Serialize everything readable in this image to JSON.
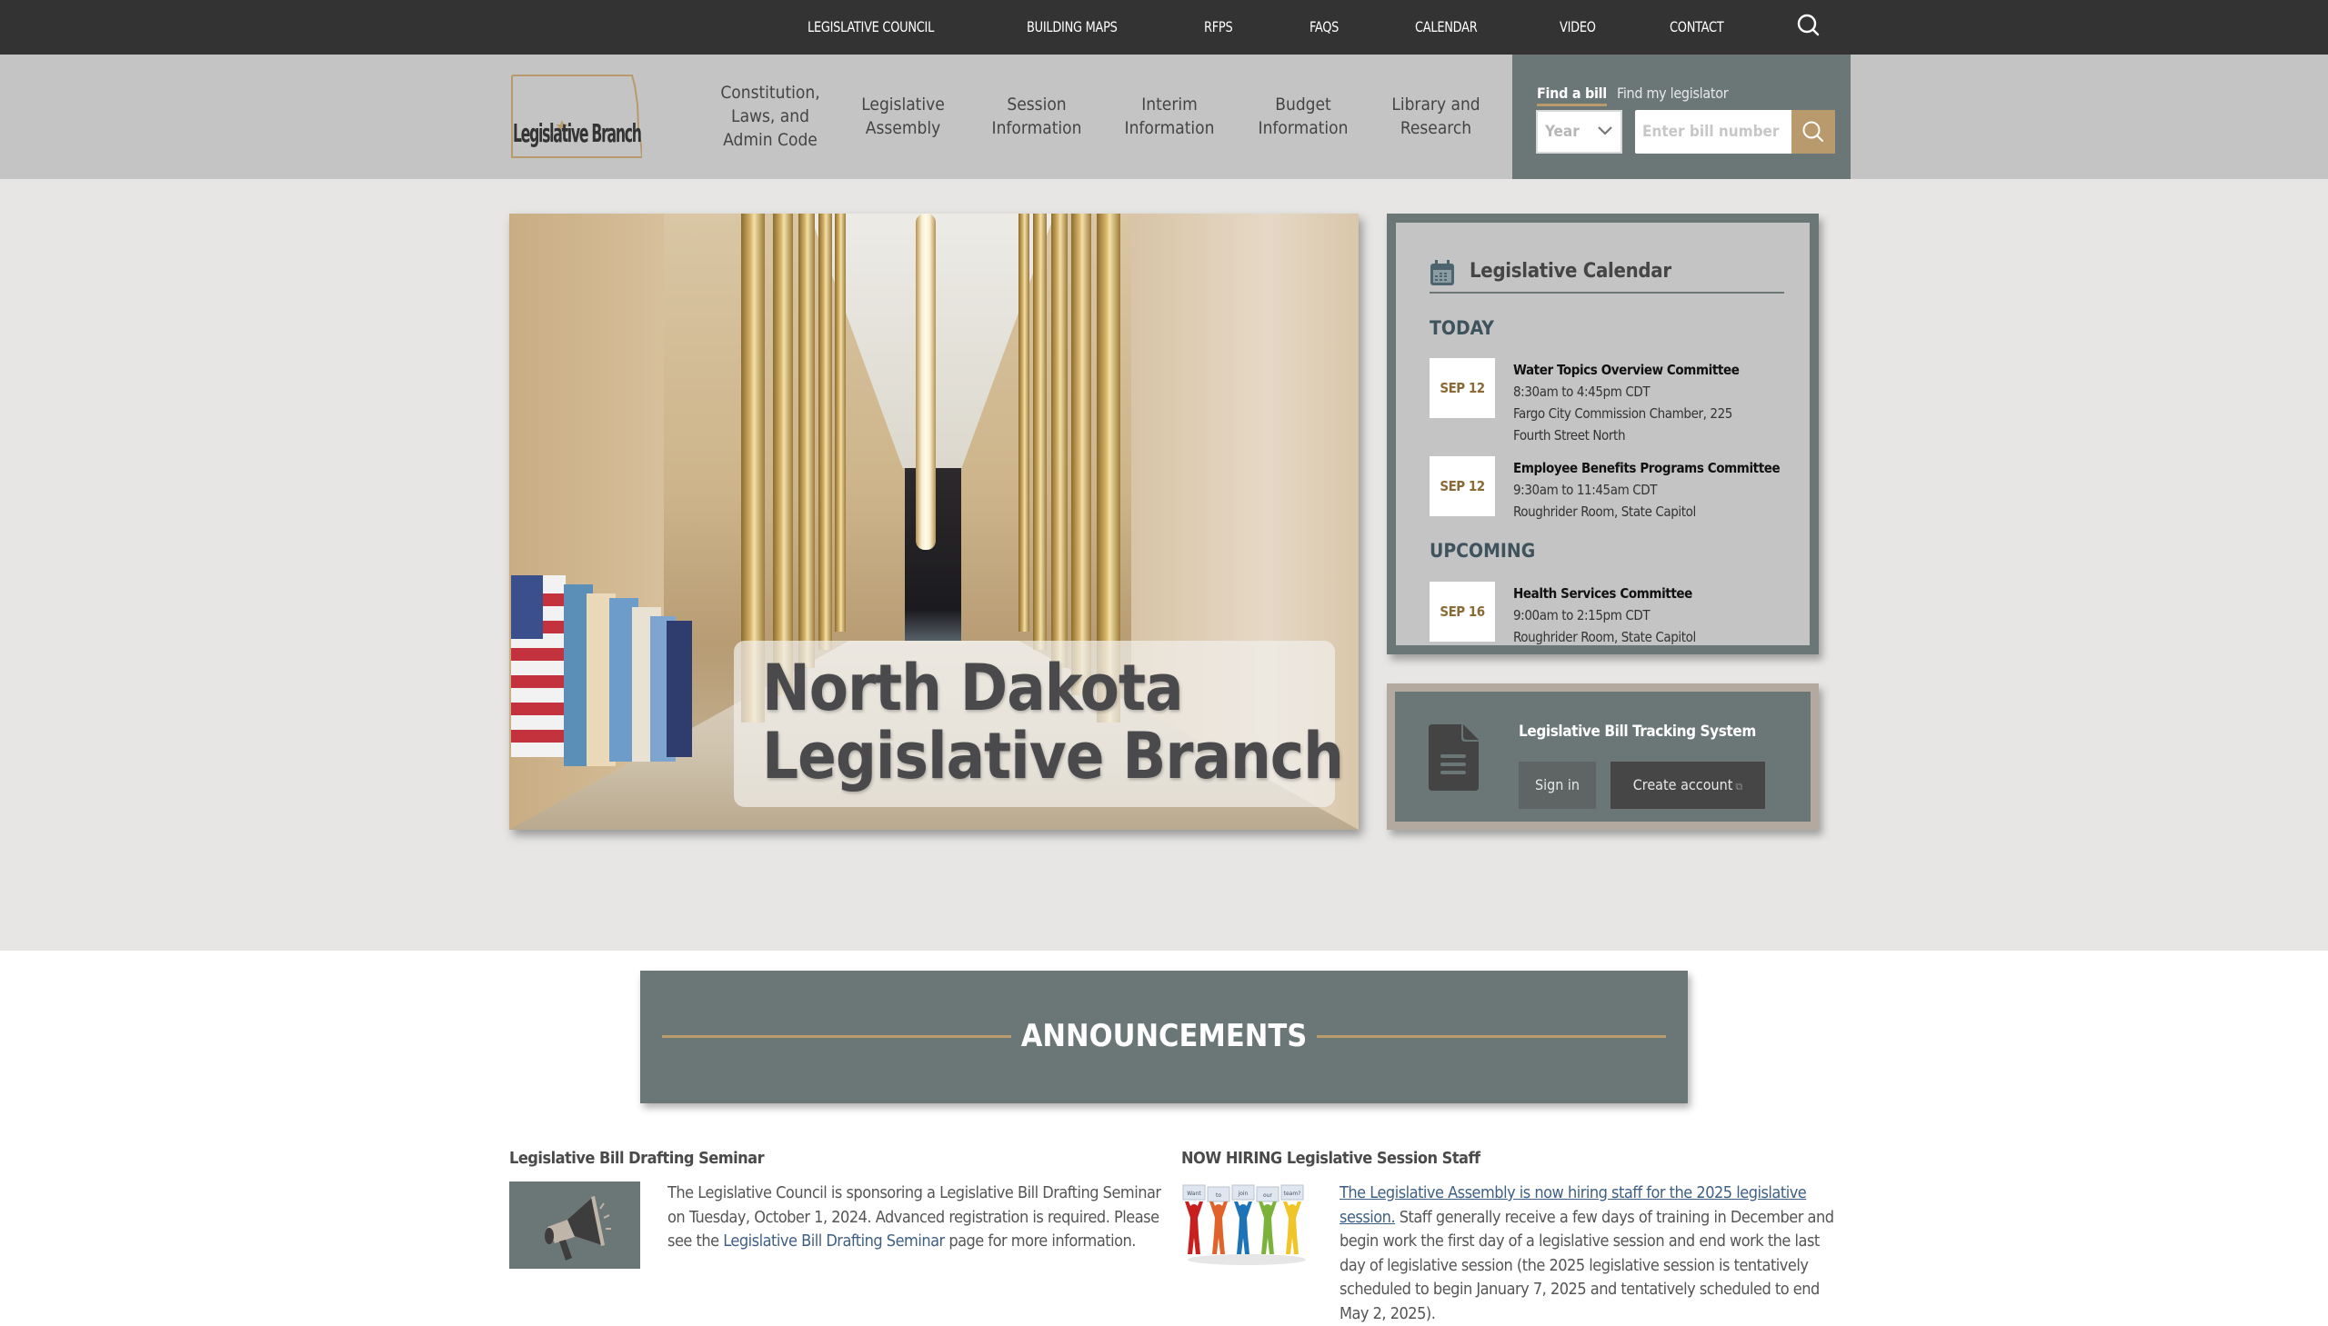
{
  "topbar": {
    "links": [
      {
        "label": "LEGISLATIVE COUNCIL"
      },
      {
        "label": "BUILDING MAPS"
      },
      {
        "label": "RFPS"
      },
      {
        "label": "FAQS"
      },
      {
        "label": "CALENDAR"
      },
      {
        "label": "VIDEO"
      },
      {
        "label": "CONTACT"
      }
    ],
    "search_icon": "search-icon"
  },
  "header": {
    "logo_text": "Legislative Branch",
    "nav": [
      {
        "line1": "Constitution,",
        "line2": "Laws, and",
        "line3": "Admin Code"
      },
      {
        "line1": "Legislative",
        "line2": "Assembly"
      },
      {
        "line1": "Session",
        "line2": "Information"
      },
      {
        "line1": "Interim",
        "line2": "Information"
      },
      {
        "line1": "Budget",
        "line2": "Information"
      },
      {
        "line1": "Library and",
        "line2": "Research"
      }
    ],
    "find": {
      "tabs": [
        {
          "label": "Find a bill",
          "active": true
        },
        {
          "label": "Find my legislator",
          "active": false
        }
      ],
      "year_select": "Year",
      "bill_placeholder": "Enter bill number",
      "search_icon": "search-icon"
    }
  },
  "hero": {
    "title_line1": "North Dakota",
    "title_line2": "Legislative Branch"
  },
  "calendar": {
    "title": "Legislative Calendar",
    "sections": [
      {
        "label": "TODAY",
        "events": [
          {
            "date": "SEP 12",
            "name": "Water Topics Overview Committee",
            "time": "8:30am to 4:45pm CDT",
            "location_line1": "Fargo City Commission Chamber, 225",
            "location_line2": "Fourth Street North"
          },
          {
            "date": "SEP 12",
            "name": "Employee Benefits Programs Committee",
            "time": "9:30am to 11:45am CDT",
            "location_line1": "Roughrider Room, State Capitol"
          }
        ]
      },
      {
        "label": "UPCOMING",
        "events": [
          {
            "date": "SEP 16",
            "name": "Health Services Committee",
            "time": "9:00am to 2:15pm CDT",
            "location_line1": "Roughrider Room, State Capitol"
          }
        ]
      }
    ]
  },
  "bill_tracking": {
    "title": "Legislative Bill Tracking System",
    "sign_in": "Sign in",
    "create_account": "Create account",
    "external_icon": "external-link-icon"
  },
  "announcements": {
    "heading": "ANNOUNCEMENTS",
    "items": [
      {
        "title": "Legislative Bill Drafting Seminar",
        "text_before": "The Legislative Council is sponsoring a Legislative Bill Drafting Seminar on Tuesday, October 1, 2024.  Advanced registration is required. Please see the ",
        "link": "Legislative Bill Drafting Seminar",
        "text_after": " page for more information.",
        "image_icon": "megaphone-icon"
      },
      {
        "title": "NOW HIRING Legislative Session Staff",
        "link": "The Legislative Assembly is now hiring staff for the 2025 legislative session.",
        "text_after": " Staff generally receive a few days of training in December and begin work the first day of a legislative session and end work the last day of legislative session (the 2025 legislative session is tentatively scheduled to begin January 7, 2025 and tentatively scheduled to end May 2, 2025).",
        "image_words": [
          "Want",
          "to",
          "join",
          "our",
          "team?"
        ],
        "image_colors": [
          "#c8201e",
          "#e0632b",
          "#1d73b8",
          "#7bb23b",
          "#f0c52a"
        ]
      }
    ]
  },
  "colors": {
    "topbar": "#333333",
    "header": "#c4c4c4",
    "slate": "#6b7677",
    "gold": "#b89a6c",
    "hero_bg": "#e7e6e4",
    "date_text": "#8a6a36",
    "link": "#3e5f84"
  }
}
